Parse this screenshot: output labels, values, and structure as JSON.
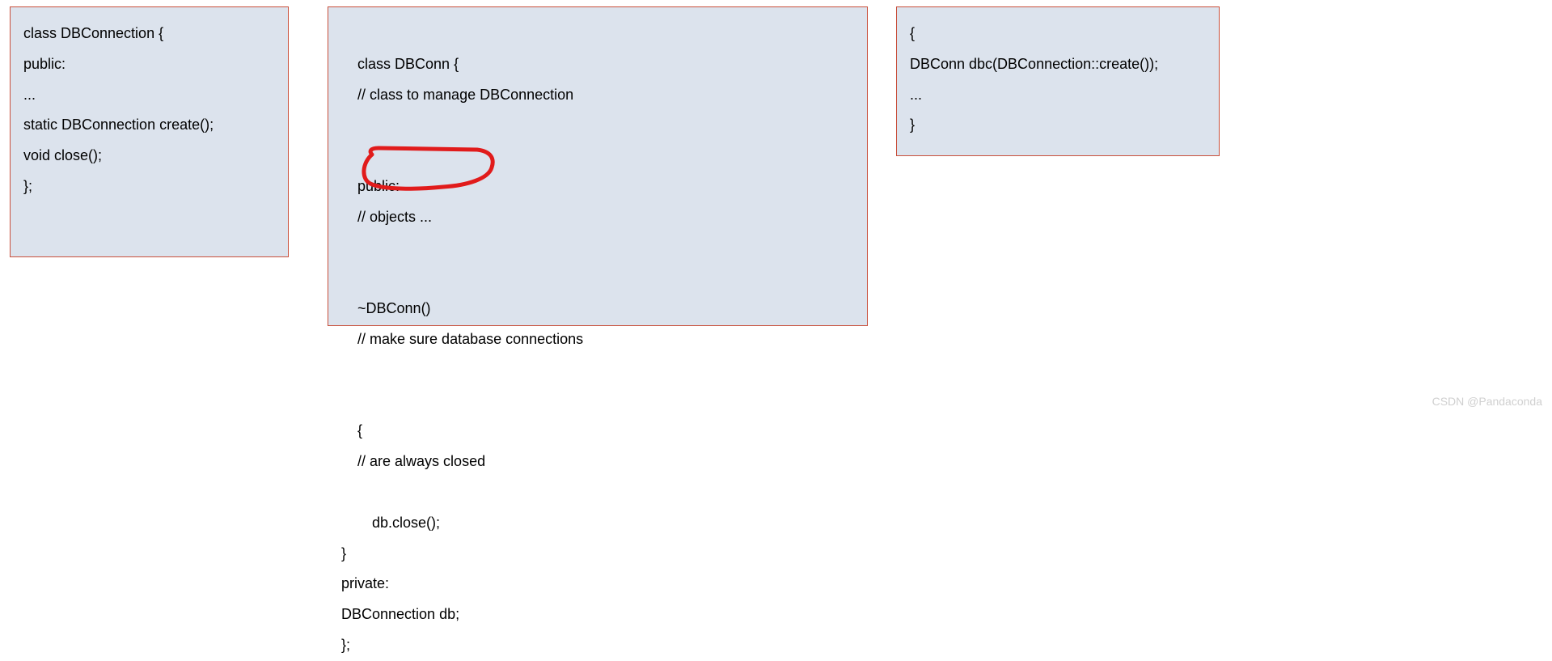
{
  "box1": {
    "l1": "class DBConnection {",
    "l2": "public:",
    "l3": "...",
    "l4": "static DBConnection create();",
    "l5": "",
    "l6": "void close();",
    "l7": "};"
  },
  "box2": {
    "r1_left": "class DBConn {",
    "r1_right": "// class to manage DBConnection",
    "r2_left": "public:",
    "r2_right": "// objects ...",
    "r3_left": "~DBConn()",
    "r3_right": "// make sure database connections",
    "r4_left": "{",
    "r4_right": "// are always closed",
    "r5": "db.close();",
    "r6": "}",
    "r7": "private:",
    "r8": "DBConnection db;",
    "r9": "};"
  },
  "box3": {
    "l1": "{",
    "l2": "DBConn dbc(DBConnection::create());",
    "l3": "...",
    "l4": "}"
  },
  "watermark": "CSDN @Pandaconda",
  "annotation_color": "#e11b1b"
}
